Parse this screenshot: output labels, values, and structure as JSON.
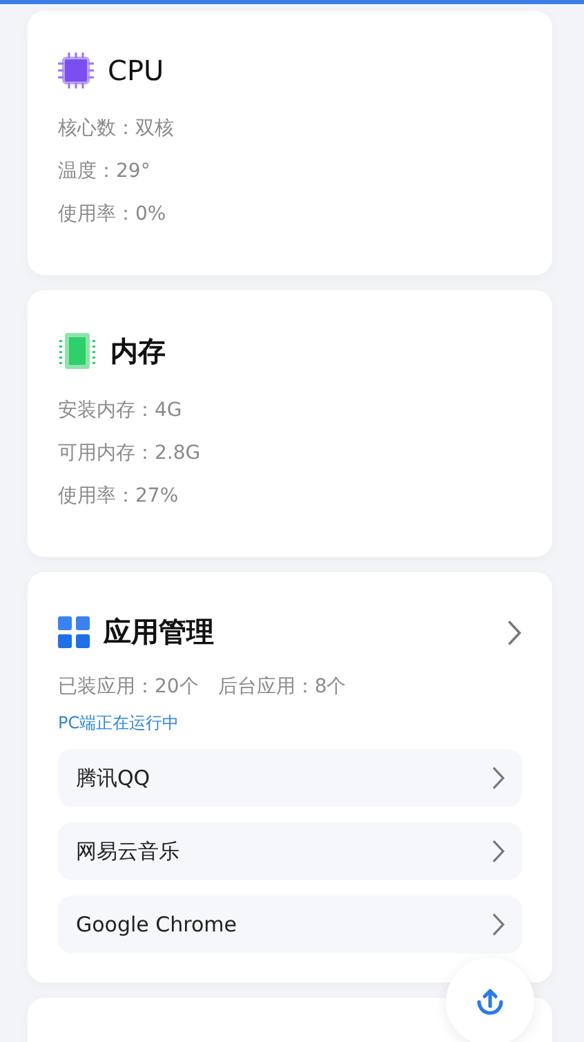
{
  "cards": [
    {
      "kind": "cpu",
      "title": "CPU",
      "rows": [
        "核心数：双核",
        "温度：29°",
        "使用率：0%"
      ]
    },
    {
      "kind": "memory",
      "title": "内存",
      "rows": [
        "安装内存：4G",
        "可用内存：2.8G",
        "使用率：27%"
      ]
    },
    {
      "kind": "apps",
      "title": "应用管理",
      "stats": [
        "已装应用：20个",
        "后台应用：8个"
      ],
      "status": "PC端正在运行中",
      "apps": [
        "腾讯QQ",
        "网易云音乐",
        "Google Chrome"
      ]
    }
  ]
}
